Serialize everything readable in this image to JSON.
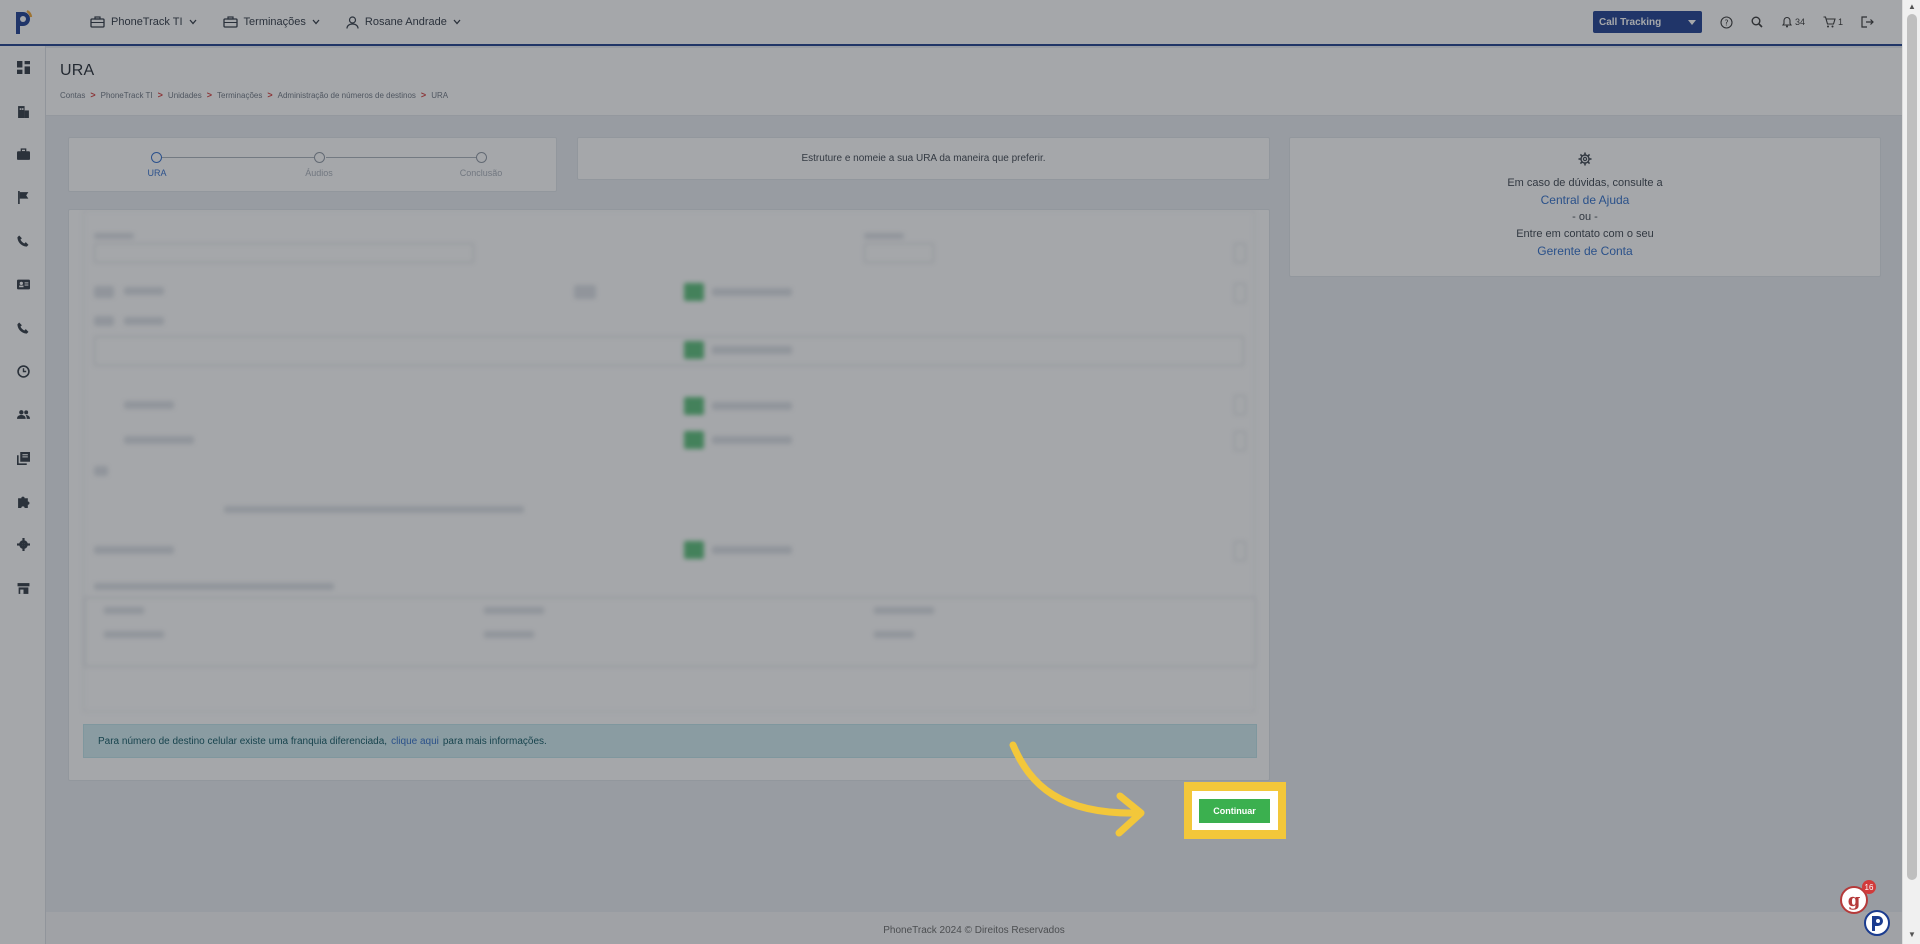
{
  "nav": {
    "items": [
      {
        "label": "PhoneTrack TI",
        "icon": "briefcase-icon"
      },
      {
        "label": "Terminações",
        "icon": "briefcase-icon"
      },
      {
        "label": "Rosane Andrade",
        "icon": "user-icon"
      }
    ],
    "product_select": "Call Tracking",
    "notifications_count": "34",
    "cart_count": "1"
  },
  "sidebar": {
    "items": [
      "dashboard-icon",
      "building-icon",
      "briefcase-icon",
      "flag-icon",
      "phone-icon",
      "contact-card-icon",
      "phone-icon",
      "history-icon",
      "users-icon",
      "library-icon",
      "puzzle-icon",
      "settings-icon",
      "store-icon"
    ]
  },
  "page": {
    "title": "URA",
    "breadcrumb": [
      "Contas",
      "PhoneTrack TI",
      "Unidades",
      "Terminações",
      "Administração de números de destinos",
      "URA"
    ]
  },
  "stepper": {
    "steps": [
      {
        "label": "URA",
        "active": true
      },
      {
        "label": "Áudios",
        "active": false
      },
      {
        "label": "Conclusão",
        "active": false
      }
    ]
  },
  "intro": {
    "text": "Estruture e nomeie a sua URA da maneira que preferir."
  },
  "help": {
    "line1": "Em caso de dúvidas, consulte a",
    "link1": "Central de Ajuda",
    "or": "- ou -",
    "line2": "Entre em contato com o seu",
    "link2": "Gerente de Conta"
  },
  "notice": {
    "before": "Para número de destino celular existe uma franquia diferenciada,",
    "link": "clique aqui",
    "after": "para mais informações."
  },
  "actions": {
    "continue": "Continuar"
  },
  "footer": {
    "text": "PhoneTrack 2024 © Direitos Reservados"
  },
  "widgets": {
    "g_count": "16"
  },
  "colors": {
    "brand_blue": "#1b3c8f",
    "accent_green": "#3bb04f",
    "highlight_yellow": "#f3c73a",
    "link_blue": "#2d6cc8"
  }
}
